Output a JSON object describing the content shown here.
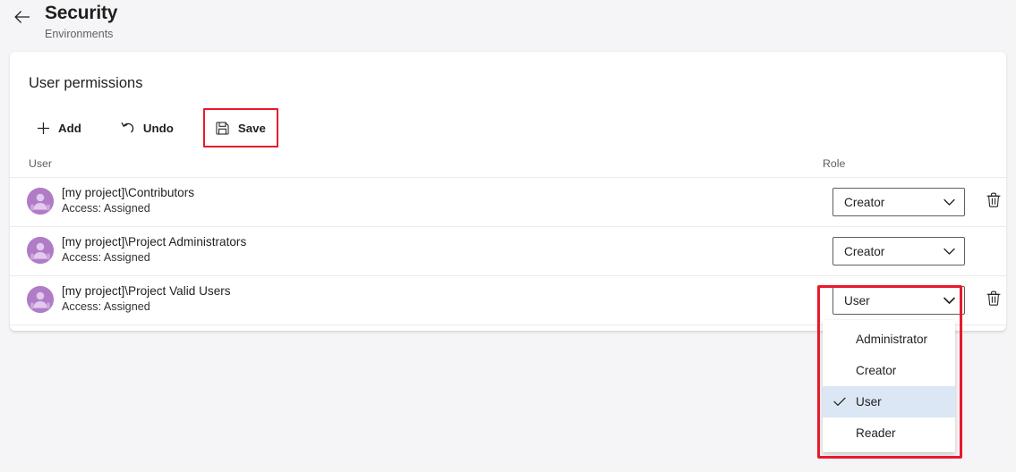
{
  "header": {
    "back_icon": "arrow-left-icon",
    "title": "Security",
    "subtitle": "Environments"
  },
  "card": {
    "title": "User permissions",
    "toolbar": {
      "add_label": "Add",
      "add_icon": "plus-icon",
      "undo_label": "Undo",
      "undo_icon": "undo-arrow-icon",
      "save_label": "Save",
      "save_icon": "floppy-disk-save-icon",
      "save_highlight_color": "#e8192c"
    },
    "columns": {
      "user": "User",
      "role": "Role"
    },
    "rows": [
      {
        "name": "[my project]\\Contributors",
        "access": "Access: Assigned",
        "role": "Creator",
        "avatar_icon": "group-avatar-icon",
        "delete_icon": "trash-icon"
      },
      {
        "name": "[my project]\\Project Administrators",
        "access": "Access: Assigned",
        "role": "Creator",
        "avatar_icon": "group-avatar-icon",
        "delete_icon": "trash-icon"
      },
      {
        "name": "[my project]\\Project Valid Users",
        "access": "Access: Assigned",
        "role": "User",
        "avatar_icon": "group-avatar-icon",
        "delete_icon": "trash-icon"
      }
    ]
  },
  "dropdown": {
    "open_for_row": 2,
    "selected_value": "User",
    "highlight_color": "#e8192c",
    "selected_row_background": "#dbe7f4",
    "options": [
      {
        "label": "Administrator",
        "selected": false
      },
      {
        "label": "Creator",
        "selected": false
      },
      {
        "label": "User",
        "selected": true
      },
      {
        "label": "Reader",
        "selected": false
      }
    ]
  },
  "colors": {
    "page_background": "#f5f5f7",
    "card_background": "#ffffff",
    "avatar": "#b07cc6",
    "accent_red": "#e8192c"
  }
}
